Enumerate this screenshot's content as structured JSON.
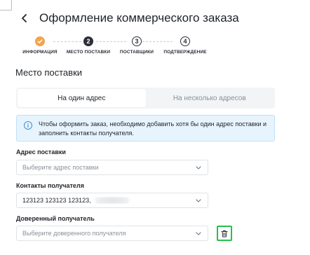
{
  "header": {
    "back_icon": "chevron-left-icon",
    "title": "Оформление коммерческого заказа"
  },
  "stepper": {
    "steps": [
      {
        "number": "1",
        "label": "ИНФОРМАЦИЯ",
        "state": "done",
        "icon": "check-icon"
      },
      {
        "number": "2",
        "label": "МЕСТО ПОСТАВКИ",
        "state": "active"
      },
      {
        "number": "3",
        "label": "ПОСТАВЩИКИ",
        "state": "todo"
      },
      {
        "number": "4",
        "label": "ПОДТВЕРЖДЕНИЕ",
        "state": "todo"
      }
    ],
    "done_color": "#f3a34c",
    "active_color": "#2b2f36"
  },
  "section": {
    "title": "Место поставки"
  },
  "address_mode": {
    "options": [
      "На один адрес",
      "На несколько адресов"
    ],
    "selected": "На один адрес"
  },
  "info": {
    "icon": "info-icon",
    "text": "Чтобы оформить заказ, необходимо добавить хотя бы один адрес поставки и заполнить контакты получателя.",
    "accent_color": "#3b8fd4"
  },
  "form": {
    "address": {
      "label": "Адрес поставки",
      "placeholder": "Выберите адрес поставки"
    },
    "contacts": {
      "label": "Контакты получателя",
      "value": "123123 123123 123123,"
    },
    "trusted": {
      "label": "Доверенный получатель",
      "placeholder": "Выберите доверенного получателя"
    }
  },
  "delete_button": {
    "icon": "trash-icon",
    "highlight_color": "#25c24a"
  }
}
